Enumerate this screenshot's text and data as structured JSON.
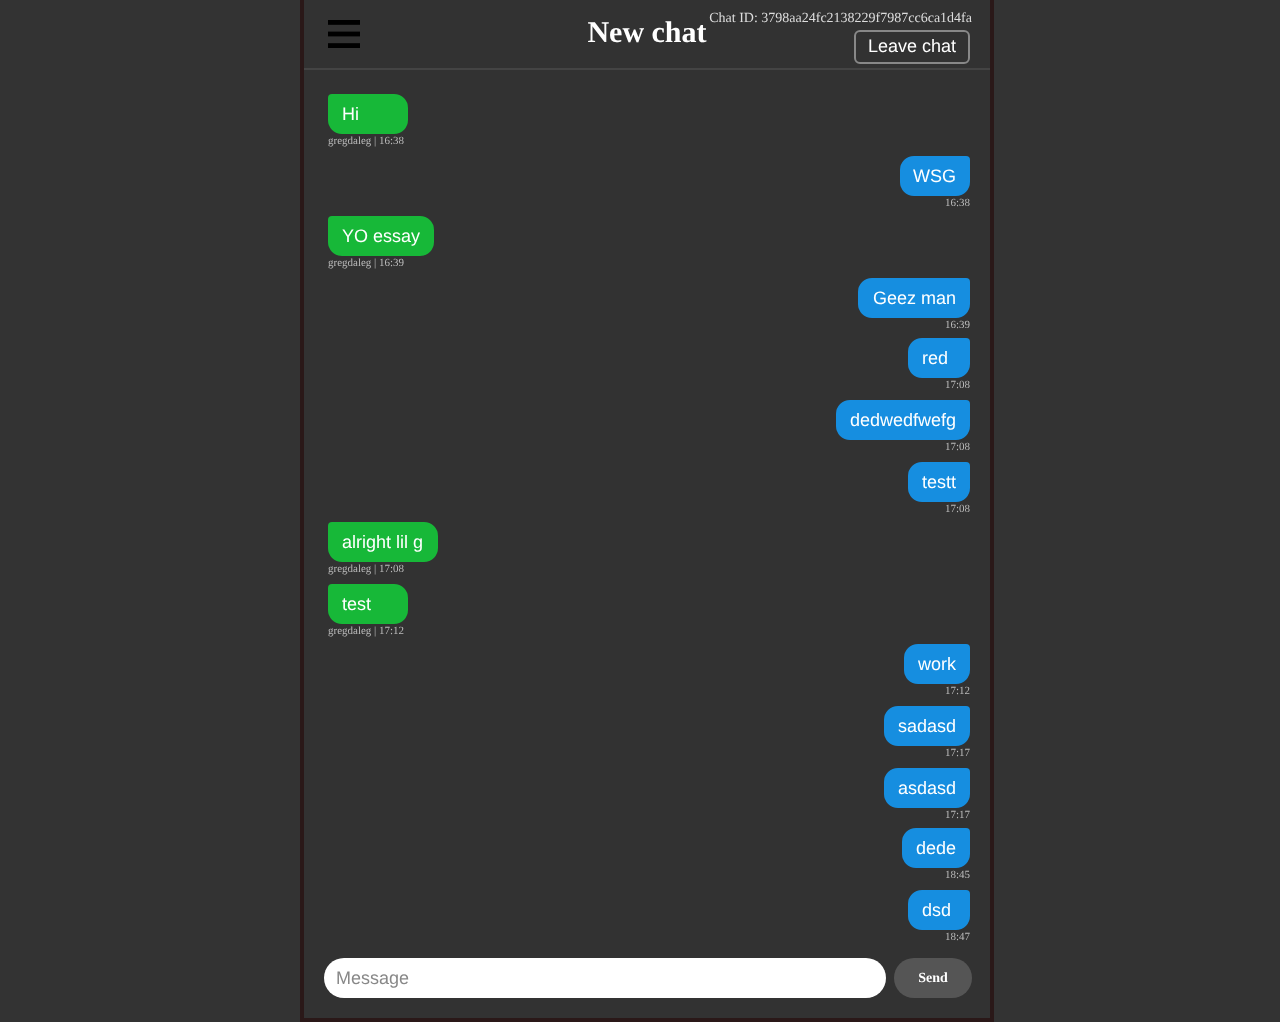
{
  "header": {
    "chat_id": "Chat ID: 3798aa24fc2138229f7987cc6ca1d4fa",
    "title": "New chat",
    "leave_button": "Leave chat"
  },
  "messages": [
    {
      "kind": "received",
      "text": "Hi",
      "meta": "gregdaleg | 16:38"
    },
    {
      "kind": "sent",
      "text": "WSG",
      "meta": "16:38"
    },
    {
      "kind": "received",
      "text": "YO essay",
      "meta": "gregdaleg | 16:39"
    },
    {
      "kind": "sent",
      "text": "Geez man",
      "meta": "16:39"
    },
    {
      "kind": "sent",
      "text": "red",
      "meta": "17:08"
    },
    {
      "kind": "sent",
      "text": "dedwedfwefg",
      "meta": "17:08"
    },
    {
      "kind": "sent",
      "text": "testt",
      "meta": "17:08"
    },
    {
      "kind": "received",
      "text": "alright lil g",
      "meta": "gregdaleg | 17:08"
    },
    {
      "kind": "received",
      "text": "test",
      "meta": "gregdaleg | 17:12"
    },
    {
      "kind": "sent",
      "text": "work",
      "meta": "17:12"
    },
    {
      "kind": "sent",
      "text": "sadasd",
      "meta": "17:17"
    },
    {
      "kind": "sent",
      "text": "asdasd",
      "meta": "17:17"
    },
    {
      "kind": "sent",
      "text": "dede",
      "meta": "18:45"
    },
    {
      "kind": "sent",
      "text": "dsd",
      "meta": "18:47"
    }
  ],
  "composer": {
    "placeholder": "Message",
    "send_button": "Send"
  }
}
